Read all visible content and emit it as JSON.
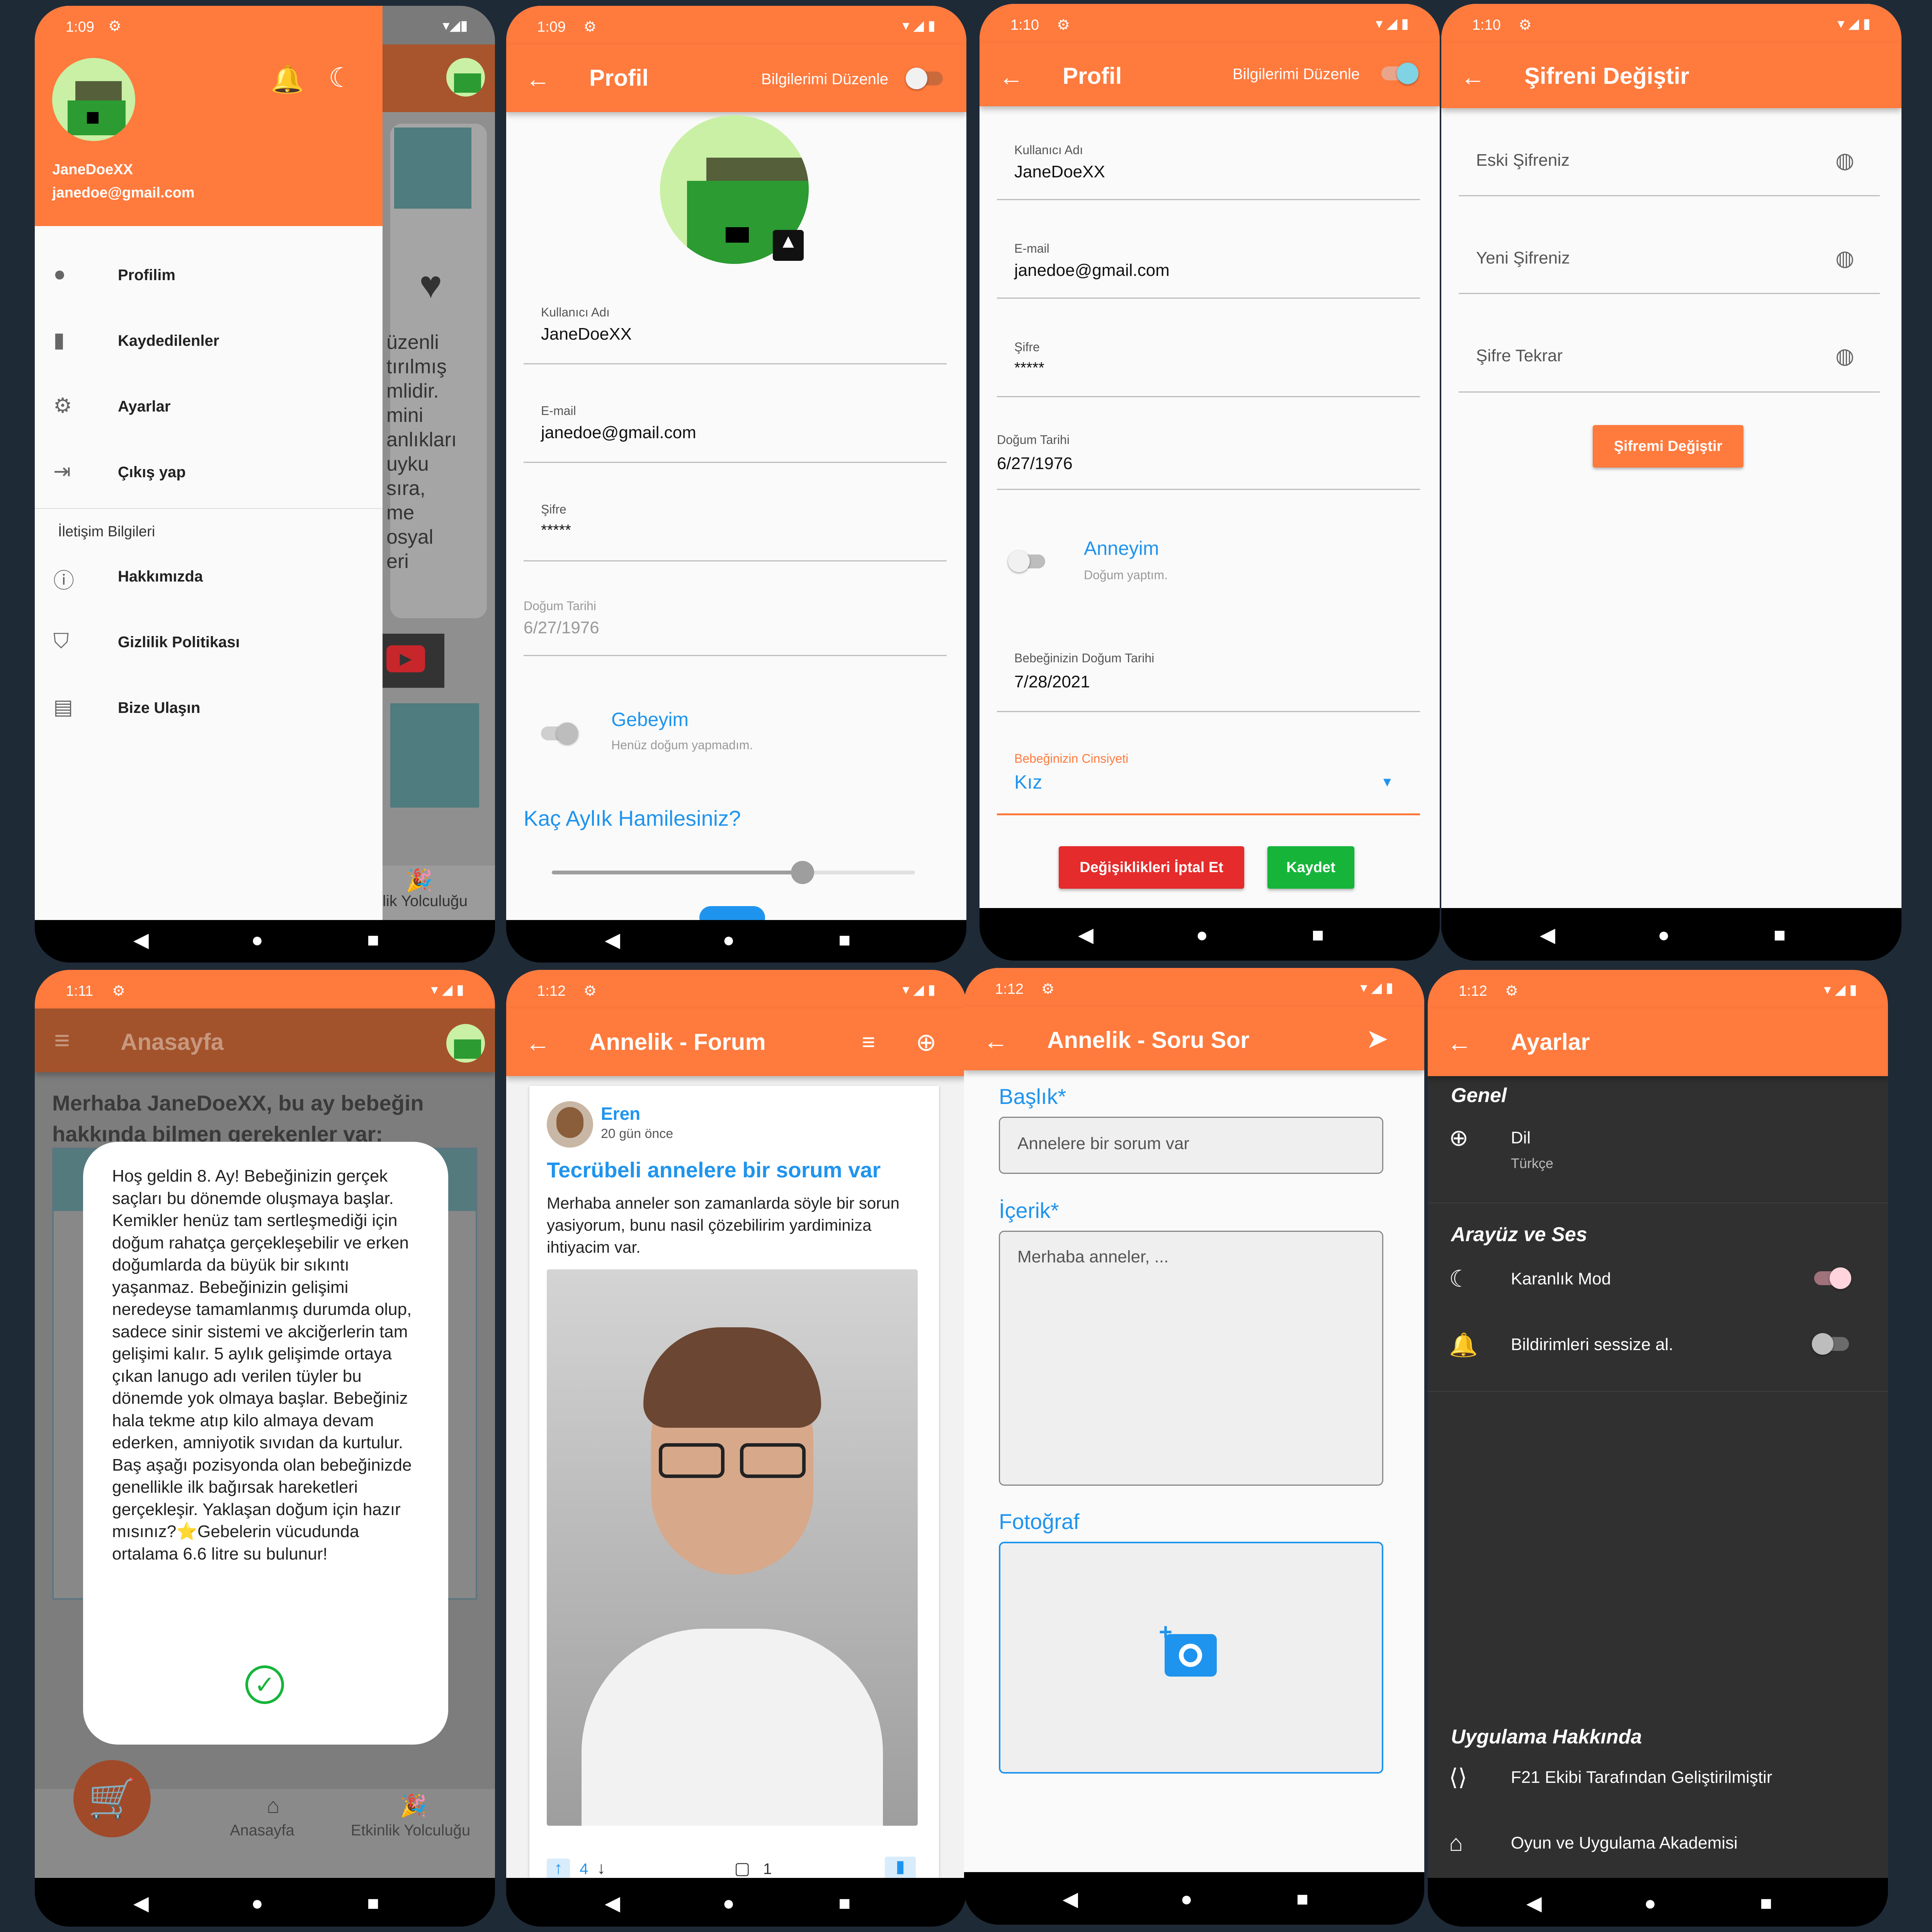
{
  "colors": {
    "primary": "#ff7a3d",
    "accent": "#1f94ee",
    "danger": "#e52b2b",
    "success": "#16b53a"
  },
  "phones": {
    "drawer": {
      "time": "1:09",
      "user": "JaneDoeXX",
      "email": "janedoe@gmail.com",
      "items": [
        "Profilim",
        "Kaydedilenler",
        "Ayarlar",
        "Çıkış yap"
      ],
      "section": "İletişim Bilgileri",
      "items2": [
        "Hakkımızda",
        "Gizlilik Politikası",
        "Bize Ulaşın"
      ],
      "bg_text": [
        "üzenli",
        "tırılmış",
        "mlidir.",
        "mini",
        "anlıkları",
        "uyku",
        "sıra,",
        "me",
        "osyal",
        "eri"
      ],
      "bg_tab": "lik Yolculuğu"
    },
    "profile": {
      "time": "1:09",
      "title": "Profil",
      "edit": "Bilgilerimi Düzenle",
      "fields": [
        {
          "label": "Kullanıcı Adı",
          "value": "JaneDoeXX"
        },
        {
          "label": "E-mail",
          "value": "janedoe@gmail.com"
        },
        {
          "label": "Şifre",
          "value": "*****"
        },
        {
          "label": "Doğum Tarihi",
          "value": "6/27/1976"
        }
      ],
      "switch_title": "Gebeyim",
      "switch_sub": "Henüz doğum yapmadım.",
      "question": "Kaç Aylık Hamilesiniz?",
      "slider_fraction": 0.69
    },
    "profile_edit": {
      "time": "1:10",
      "title": "Profil",
      "edit": "Bilgilerimi Düzenle",
      "fields": [
        {
          "label": "Kullanıcı Adı",
          "value": "JaneDoeXX"
        },
        {
          "label": "E-mail",
          "value": "janedoe@gmail.com"
        },
        {
          "label": "Şifre",
          "value": "*****"
        },
        {
          "label": "Doğum Tarihi",
          "value": "6/27/1976"
        }
      ],
      "switch_title": "Anneyim",
      "switch_sub": "Doğum yaptım.",
      "baby_label": "Bebeğinizin Doğum Tarihi",
      "baby_value": "7/28/2021",
      "gender_label": "Bebeğinizin Cinsiyeti",
      "gender_value": "Kız",
      "cancel": "Değişiklikleri İptal Et",
      "save": "Kaydet"
    },
    "password": {
      "time": "1:10",
      "title": "Şifreni Değiştir",
      "fields": [
        "Eski Şifreniz",
        "Yeni Şifreniz",
        "Şifre Tekrar"
      ],
      "button": "Şifremi Değiştir"
    },
    "home": {
      "time": "1:11",
      "title": "Anasayfa",
      "greeting": "Merhaba JaneDoeXX, bu ay bebeğin hakkında bilmen gerekenler var:",
      "dialog": "Hoş geldin 8. Ay! Bebeğinizin gerçek saçları bu dönemde oluşmaya başlar. Kemikler henüz tam sertleşmediği için doğum rahatça gerçekleşebilir ve erken doğumlarda da büyük bir sıkıntı yaşanmaz. Bebeğinizin gelişimi neredeyse tamamlanmış durumda olup, sadece sinir sistemi ve akciğerlerin tam gelişimi kalır. 5 aylık gelişimde ortaya çıkan lanugo adı verilen tüyler bu dönemde yok olmaya başlar. Bebeğiniz hala tekme atıp kilo almaya devam ederken, amniyotik sıvıdan da kurtulur. Baş aşağı pozisyonda olan bebeğinizde genellikle ilk bağırsak hareketleri gerçekleşir. Yaklaşan doğum için hazır mısınız?⭐Gebelerin vücudunda ortalama 6.6 litre su bulunur!",
      "tabs": [
        "Anasayfa",
        "Etkinlik Yolculuğu"
      ]
    },
    "forum": {
      "time": "1:12",
      "title": "Annelik - Forum",
      "author": "Eren",
      "ago": "20 gün önce",
      "post_title": "Tecrübeli annelere bir sorum var",
      "post_body": "Merhaba anneler son zamanlarda söyle bir sorun yasiyorum, bunu nasil çözebilirim yardiminiza ihtiyacim var.",
      "votes": "4",
      "comments": "1"
    },
    "ask": {
      "time": "1:12",
      "title": "Annelik - Soru Sor",
      "l1": "Başlık*",
      "p1": "Annelere bir sorum var",
      "l2": "İçerik*",
      "p2": "Merhaba anneler, ...",
      "l3": "Fotoğraf"
    },
    "settings": {
      "time": "1:12",
      "title": "Ayarlar",
      "general": "Genel",
      "lang": "Dil",
      "lang_val": "Türkçe",
      "ui": "Arayüz ve Ses",
      "dark": "Karanlık Mod",
      "mute": "Bildirimleri sessize al.",
      "about": "Uygulama Hakkında",
      "a1": "F21 Ekibi Tarafından Geliştirilmiştir",
      "a2": "Oyun ve Uygulama Akademisi"
    }
  }
}
